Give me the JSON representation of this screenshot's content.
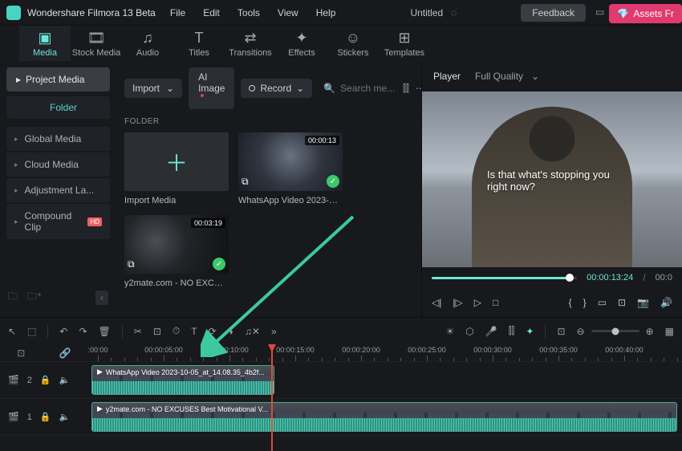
{
  "app": {
    "title": "Wondershare Filmora 13 Beta",
    "document": "Untitled"
  },
  "menu": [
    "File",
    "Edit",
    "Tools",
    "View",
    "Help"
  ],
  "topActions": {
    "feedback": "Feedback",
    "assets": "Assets Fr"
  },
  "toolTabs": [
    {
      "label": "Media",
      "icon": "▣"
    },
    {
      "label": "Stock Media",
      "icon": "🎞"
    },
    {
      "label": "Audio",
      "icon": "♫"
    },
    {
      "label": "Titles",
      "icon": "T"
    },
    {
      "label": "Transitions",
      "icon": "⇄"
    },
    {
      "label": "Effects",
      "icon": "✦"
    },
    {
      "label": "Stickers",
      "icon": "☺"
    },
    {
      "label": "Templates",
      "icon": "⊞"
    }
  ],
  "sidebar": {
    "projectMedia": "Project Media",
    "folderTab": "Folder",
    "items": [
      {
        "label": "Global Media"
      },
      {
        "label": "Cloud Media"
      },
      {
        "label": "Adjustment La..."
      },
      {
        "label": "Compound Clip",
        "badge": "HD"
      }
    ]
  },
  "mediaToolbar": {
    "import": "Import",
    "aiImage": "AI Image",
    "record": "Record",
    "searchPlaceholder": "Search me..."
  },
  "folderLabel": "FOLDER",
  "mediaItems": [
    {
      "name": "Import Media",
      "type": "import"
    },
    {
      "name": "WhatsApp Video 2023-10-05...",
      "duration": "00:00:13",
      "type": "video",
      "thumb": "vr"
    },
    {
      "name": "y2mate.com - NO EXCUSES ...",
      "duration": "00:03:19",
      "type": "video",
      "thumb": "excuses"
    }
  ],
  "player": {
    "tab": "Player",
    "quality": "Full Quality",
    "caption": "Is that what's stopping you right now?",
    "timeCurrent": "00:00:13:24",
    "timeTotal": "00:0"
  },
  "timeline": {
    "rulerLabels": [
      ":00:00",
      "00:00:05:00",
      "00:00:10:00",
      "00:00:15:00",
      "00:00:20:00",
      "00:00:25:00",
      "00:00:30:00",
      "00:00:35:00",
      "00:00:40:00"
    ],
    "trackLabels": {
      "t2": "2",
      "t1": "1"
    },
    "clips": [
      {
        "track": 0,
        "label": "WhatsApp Video 2023-10-05_at_14.08.35_4b2f..."
      },
      {
        "track": 1,
        "label": "y2mate.com - NO EXCUSES  Best Motivational V..."
      }
    ],
    "playheadPx": 228
  },
  "colors": {
    "accent": "#6ee7d9",
    "danger": "#e04a38"
  }
}
